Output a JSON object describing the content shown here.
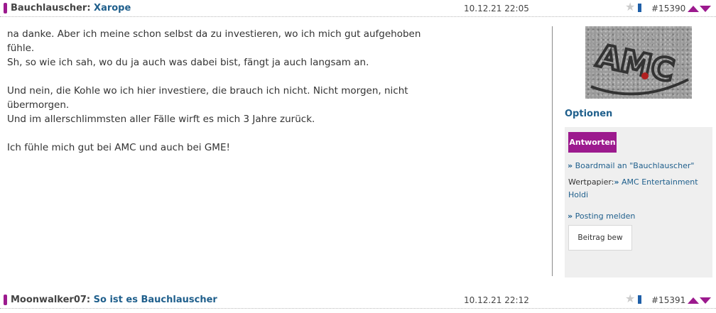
{
  "post1": {
    "author": "Bauchlauscher",
    "separator": ":",
    "subject": "Xarope",
    "date": "10.12.21 22:05",
    "number": "#15390",
    "body": [
      "na danke. Aber ich meine schon selbst da zu investieren, wo ich mich gut aufgehoben",
      "fühle.",
      "Sh, so wie ich sah, wo du ja auch was dabei bist, fängt ja auch langsam an.",
      "",
      "Und nein, die Kohle wo ich hier investiere, die brauch ich nicht. Nicht morgen, nicht",
      "übermorgen.",
      "Und im allerschlimmsten aller Fälle wirft es mich 3 Jahre zurück.",
      "",
      "Ich fühle mich gut bei AMC und auch bei GME!"
    ]
  },
  "sidebar": {
    "image_text": "AMC",
    "options_title": "Optionen",
    "reply_label": "Antworten",
    "boardmail_label": "Boardmail an \"Bauchlauscher\"",
    "chevron": "»",
    "wertpapier_label": "Wertpapier:",
    "wertpapier_value": "AMC Entertainment Holdi",
    "report_label": "Posting melden",
    "beitrag_label": "Beitrag bew"
  },
  "post2": {
    "author": "Moonwalker07",
    "separator": ":",
    "subject": "So ist es Bauchlauscher",
    "date": "10.12.21 22:12",
    "number": "#15391"
  },
  "icons": {
    "star": "star-icon",
    "flag": "bookmark-flag-icon",
    "up": "arrow-up-icon",
    "down": "arrow-down-icon"
  },
  "colors": {
    "accent": "#9c1a8e",
    "link": "#1f5f8c",
    "panel": "#efefef"
  }
}
